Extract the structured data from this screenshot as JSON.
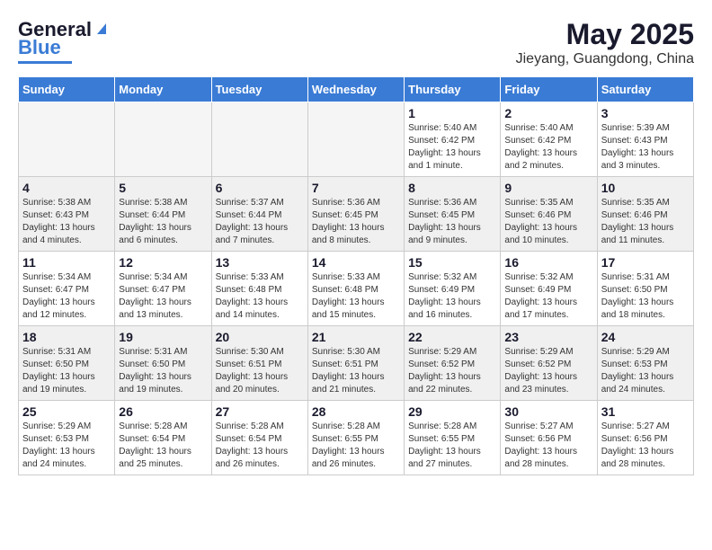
{
  "header": {
    "logo_general": "General",
    "logo_blue": "Blue",
    "month": "May 2025",
    "location": "Jieyang, Guangdong, China"
  },
  "days_of_week": [
    "Sunday",
    "Monday",
    "Tuesday",
    "Wednesday",
    "Thursday",
    "Friday",
    "Saturday"
  ],
  "weeks": [
    {
      "shaded": false,
      "days": [
        {
          "num": "",
          "empty": true
        },
        {
          "num": "",
          "empty": true
        },
        {
          "num": "",
          "empty": true
        },
        {
          "num": "",
          "empty": true
        },
        {
          "num": "1",
          "sunrise": "Sunrise: 5:40 AM",
          "sunset": "Sunset: 6:42 PM",
          "daylight": "Daylight: 13 hours and 1 minute."
        },
        {
          "num": "2",
          "sunrise": "Sunrise: 5:40 AM",
          "sunset": "Sunset: 6:42 PM",
          "daylight": "Daylight: 13 hours and 2 minutes."
        },
        {
          "num": "3",
          "sunrise": "Sunrise: 5:39 AM",
          "sunset": "Sunset: 6:43 PM",
          "daylight": "Daylight: 13 hours and 3 minutes."
        }
      ]
    },
    {
      "shaded": true,
      "days": [
        {
          "num": "4",
          "sunrise": "Sunrise: 5:38 AM",
          "sunset": "Sunset: 6:43 PM",
          "daylight": "Daylight: 13 hours and 4 minutes."
        },
        {
          "num": "5",
          "sunrise": "Sunrise: 5:38 AM",
          "sunset": "Sunset: 6:44 PM",
          "daylight": "Daylight: 13 hours and 6 minutes."
        },
        {
          "num": "6",
          "sunrise": "Sunrise: 5:37 AM",
          "sunset": "Sunset: 6:44 PM",
          "daylight": "Daylight: 13 hours and 7 minutes."
        },
        {
          "num": "7",
          "sunrise": "Sunrise: 5:36 AM",
          "sunset": "Sunset: 6:45 PM",
          "daylight": "Daylight: 13 hours and 8 minutes."
        },
        {
          "num": "8",
          "sunrise": "Sunrise: 5:36 AM",
          "sunset": "Sunset: 6:45 PM",
          "daylight": "Daylight: 13 hours and 9 minutes."
        },
        {
          "num": "9",
          "sunrise": "Sunrise: 5:35 AM",
          "sunset": "Sunset: 6:46 PM",
          "daylight": "Daylight: 13 hours and 10 minutes."
        },
        {
          "num": "10",
          "sunrise": "Sunrise: 5:35 AM",
          "sunset": "Sunset: 6:46 PM",
          "daylight": "Daylight: 13 hours and 11 minutes."
        }
      ]
    },
    {
      "shaded": false,
      "days": [
        {
          "num": "11",
          "sunrise": "Sunrise: 5:34 AM",
          "sunset": "Sunset: 6:47 PM",
          "daylight": "Daylight: 13 hours and 12 minutes."
        },
        {
          "num": "12",
          "sunrise": "Sunrise: 5:34 AM",
          "sunset": "Sunset: 6:47 PM",
          "daylight": "Daylight: 13 hours and 13 minutes."
        },
        {
          "num": "13",
          "sunrise": "Sunrise: 5:33 AM",
          "sunset": "Sunset: 6:48 PM",
          "daylight": "Daylight: 13 hours and 14 minutes."
        },
        {
          "num": "14",
          "sunrise": "Sunrise: 5:33 AM",
          "sunset": "Sunset: 6:48 PM",
          "daylight": "Daylight: 13 hours and 15 minutes."
        },
        {
          "num": "15",
          "sunrise": "Sunrise: 5:32 AM",
          "sunset": "Sunset: 6:49 PM",
          "daylight": "Daylight: 13 hours and 16 minutes."
        },
        {
          "num": "16",
          "sunrise": "Sunrise: 5:32 AM",
          "sunset": "Sunset: 6:49 PM",
          "daylight": "Daylight: 13 hours and 17 minutes."
        },
        {
          "num": "17",
          "sunrise": "Sunrise: 5:31 AM",
          "sunset": "Sunset: 6:50 PM",
          "daylight": "Daylight: 13 hours and 18 minutes."
        }
      ]
    },
    {
      "shaded": true,
      "days": [
        {
          "num": "18",
          "sunrise": "Sunrise: 5:31 AM",
          "sunset": "Sunset: 6:50 PM",
          "daylight": "Daylight: 13 hours and 19 minutes."
        },
        {
          "num": "19",
          "sunrise": "Sunrise: 5:31 AM",
          "sunset": "Sunset: 6:50 PM",
          "daylight": "Daylight: 13 hours and 19 minutes."
        },
        {
          "num": "20",
          "sunrise": "Sunrise: 5:30 AM",
          "sunset": "Sunset: 6:51 PM",
          "daylight": "Daylight: 13 hours and 20 minutes."
        },
        {
          "num": "21",
          "sunrise": "Sunrise: 5:30 AM",
          "sunset": "Sunset: 6:51 PM",
          "daylight": "Daylight: 13 hours and 21 minutes."
        },
        {
          "num": "22",
          "sunrise": "Sunrise: 5:29 AM",
          "sunset": "Sunset: 6:52 PM",
          "daylight": "Daylight: 13 hours and 22 minutes."
        },
        {
          "num": "23",
          "sunrise": "Sunrise: 5:29 AM",
          "sunset": "Sunset: 6:52 PM",
          "daylight": "Daylight: 13 hours and 23 minutes."
        },
        {
          "num": "24",
          "sunrise": "Sunrise: 5:29 AM",
          "sunset": "Sunset: 6:53 PM",
          "daylight": "Daylight: 13 hours and 24 minutes."
        }
      ]
    },
    {
      "shaded": false,
      "days": [
        {
          "num": "25",
          "sunrise": "Sunrise: 5:29 AM",
          "sunset": "Sunset: 6:53 PM",
          "daylight": "Daylight: 13 hours and 24 minutes."
        },
        {
          "num": "26",
          "sunrise": "Sunrise: 5:28 AM",
          "sunset": "Sunset: 6:54 PM",
          "daylight": "Daylight: 13 hours and 25 minutes."
        },
        {
          "num": "27",
          "sunrise": "Sunrise: 5:28 AM",
          "sunset": "Sunset: 6:54 PM",
          "daylight": "Daylight: 13 hours and 26 minutes."
        },
        {
          "num": "28",
          "sunrise": "Sunrise: 5:28 AM",
          "sunset": "Sunset: 6:55 PM",
          "daylight": "Daylight: 13 hours and 26 minutes."
        },
        {
          "num": "29",
          "sunrise": "Sunrise: 5:28 AM",
          "sunset": "Sunset: 6:55 PM",
          "daylight": "Daylight: 13 hours and 27 minutes."
        },
        {
          "num": "30",
          "sunrise": "Sunrise: 5:27 AM",
          "sunset": "Sunset: 6:56 PM",
          "daylight": "Daylight: 13 hours and 28 minutes."
        },
        {
          "num": "31",
          "sunrise": "Sunrise: 5:27 AM",
          "sunset": "Sunset: 6:56 PM",
          "daylight": "Daylight: 13 hours and 28 minutes."
        }
      ]
    }
  ]
}
